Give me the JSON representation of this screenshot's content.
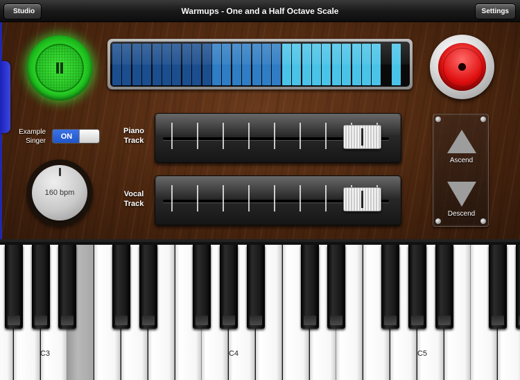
{
  "navbar": {
    "back_label": "Studio",
    "title": "Warmups - One and a Half Octave Scale",
    "settings_label": "Settings"
  },
  "controls": {
    "example_singer_label": "Example Singer",
    "example_singer_state": "ON",
    "tempo_label": "160 bpm",
    "piano_track_label": "Piano Track",
    "vocal_track_label": "Vocal Track",
    "piano_track_level": 0.88,
    "vocal_track_level": 0.88,
    "ascend_label": "Ascend",
    "descend_label": "Descend"
  },
  "meter": {
    "levels": [
      1,
      1,
      1,
      1,
      1,
      1,
      1,
      1,
      1,
      1,
      1,
      1,
      1,
      1,
      1,
      1,
      1,
      1,
      1,
      1,
      1,
      1,
      1,
      1,
      1,
      1,
      1,
      0,
      1,
      0,
      0
    ],
    "colors": {
      "dark": "#1b4e8f",
      "mid": "#2f7dc4",
      "light": "#4ac3e8"
    }
  },
  "keyboard": {
    "labels": {
      "c3": "C3",
      "c4": "C4",
      "c5": "C5"
    }
  },
  "colors": {
    "play_green": "#2fe02a",
    "record_red": "#e01010",
    "toggle_blue": "#1f56c8",
    "side_tab_blue": "#2129b0"
  },
  "icons": {
    "play": "pause-icon",
    "record": "record-icon",
    "ascend": "triangle-up-icon",
    "descend": "triangle-down-icon"
  }
}
